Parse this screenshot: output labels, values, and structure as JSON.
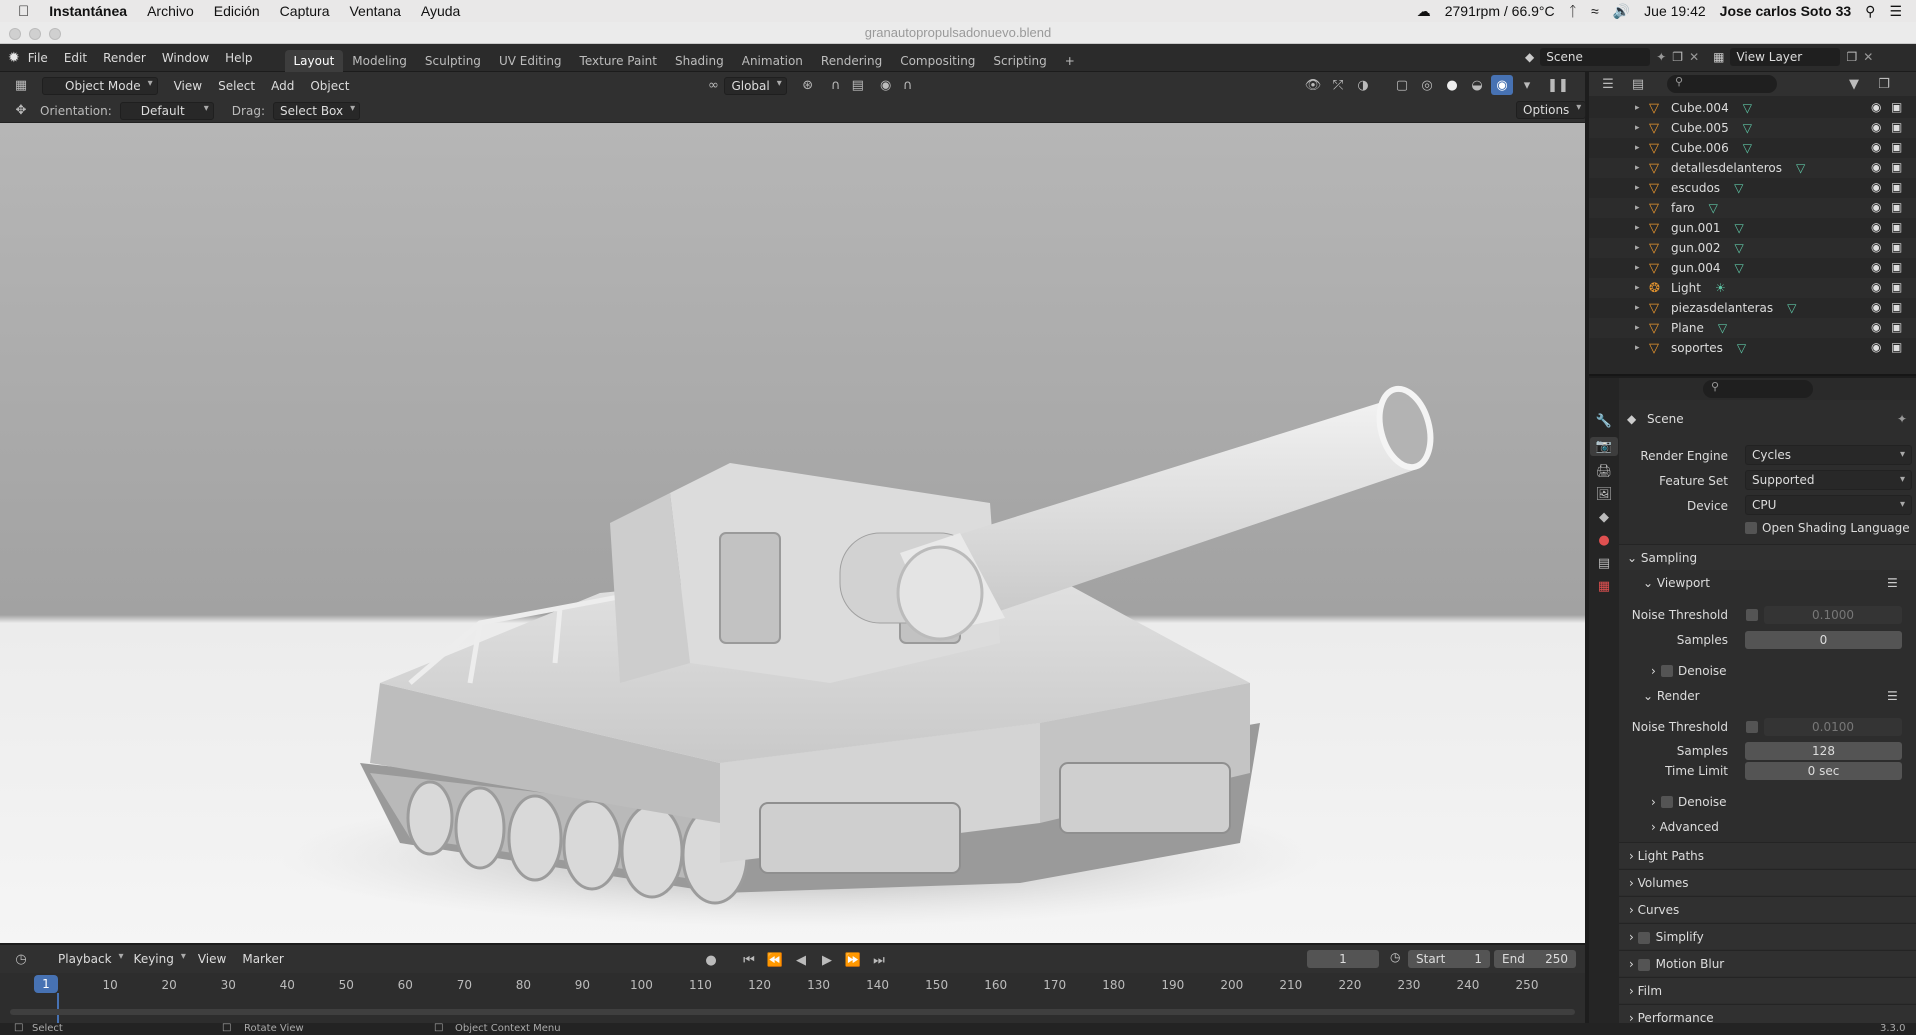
{
  "mac_menu": {
    "app": "Instantánea",
    "items": [
      "Archivo",
      "Edición",
      "Captura",
      "Ventana",
      "Ayuda"
    ],
    "status_fan": "2791rpm / 66.9°C",
    "clock": "Jue 19:42",
    "user": "Jose carlos Soto 33"
  },
  "window_title": "granautopropulsadonuevo.blend",
  "menus": [
    "File",
    "Edit",
    "Render",
    "Window",
    "Help"
  ],
  "workspaces": [
    "Layout",
    "Modeling",
    "Sculpting",
    "UV Editing",
    "Texture Paint",
    "Shading",
    "Animation",
    "Rendering",
    "Compositing",
    "Scripting"
  ],
  "workspace_add": "+",
  "scene": {
    "scene_name": "Scene",
    "view_layer": "View Layer"
  },
  "viewport_header": {
    "mode": "Object Mode",
    "menus": [
      "View",
      "Select",
      "Add",
      "Object"
    ],
    "transform": "Global"
  },
  "tool_settings": {
    "orientation_label": "Orientation:",
    "orientation_value": "Default",
    "drag_label": "Drag:",
    "drag_value": "Select Box",
    "options": "Options"
  },
  "outliner": [
    {
      "name": "Cube.004",
      "type": "mesh"
    },
    {
      "name": "Cube.005",
      "type": "mesh"
    },
    {
      "name": "Cube.006",
      "type": "mesh"
    },
    {
      "name": "detallesdelanteros",
      "type": "mesh"
    },
    {
      "name": "escudos",
      "type": "mesh"
    },
    {
      "name": "faro",
      "type": "mesh"
    },
    {
      "name": "gun.001",
      "type": "mesh"
    },
    {
      "name": "gun.002",
      "type": "mesh"
    },
    {
      "name": "gun.004",
      "type": "mesh"
    },
    {
      "name": "Light",
      "type": "light"
    },
    {
      "name": "piezasdelanteras",
      "type": "mesh"
    },
    {
      "name": "Plane",
      "type": "mesh"
    },
    {
      "name": "soportes",
      "type": "mesh"
    }
  ],
  "properties": {
    "context": "Scene",
    "render_engine_label": "Render Engine",
    "render_engine": "Cycles",
    "feature_set_label": "Feature Set",
    "feature_set": "Supported",
    "device_label": "Device",
    "device": "CPU",
    "osl_label": "Open Shading Language",
    "sampling": "Sampling",
    "viewport": "Viewport",
    "noise_threshold_label": "Noise Threshold",
    "vp_noise_threshold": "0.1000",
    "samples_label": "Samples",
    "vp_samples": "0",
    "denoise_label": "Denoise",
    "render": "Render",
    "r_noise_threshold": "0.0100",
    "r_samples": "128",
    "time_limit_label": "Time Limit",
    "time_limit": "0 sec",
    "advanced": "Advanced",
    "sections": [
      "Light Paths",
      "Volumes",
      "Curves",
      "Simplify",
      "Motion Blur",
      "Film",
      "Performance"
    ]
  },
  "timeline": {
    "menus": [
      "Playback",
      "Keying",
      "View",
      "Marker"
    ],
    "current_frame": "1",
    "start_label": "Start",
    "start": "1",
    "end_label": "End",
    "end": "250",
    "ticks": [
      "10",
      "20",
      "30",
      "40",
      "50",
      "60",
      "70",
      "80",
      "90",
      "100",
      "110",
      "120",
      "130",
      "140",
      "150",
      "160",
      "170",
      "180",
      "190",
      "200",
      "210",
      "220",
      "230",
      "240",
      "250"
    ]
  },
  "statusbar": {
    "select": "Select",
    "rotate": "Rotate View",
    "context_menu": "Object Context Menu",
    "version": "3.3.0"
  },
  "colors": {
    "accent": "#4772b3",
    "mesh_icon": "#e8962e",
    "mesh_data": "#5ec4a4"
  }
}
